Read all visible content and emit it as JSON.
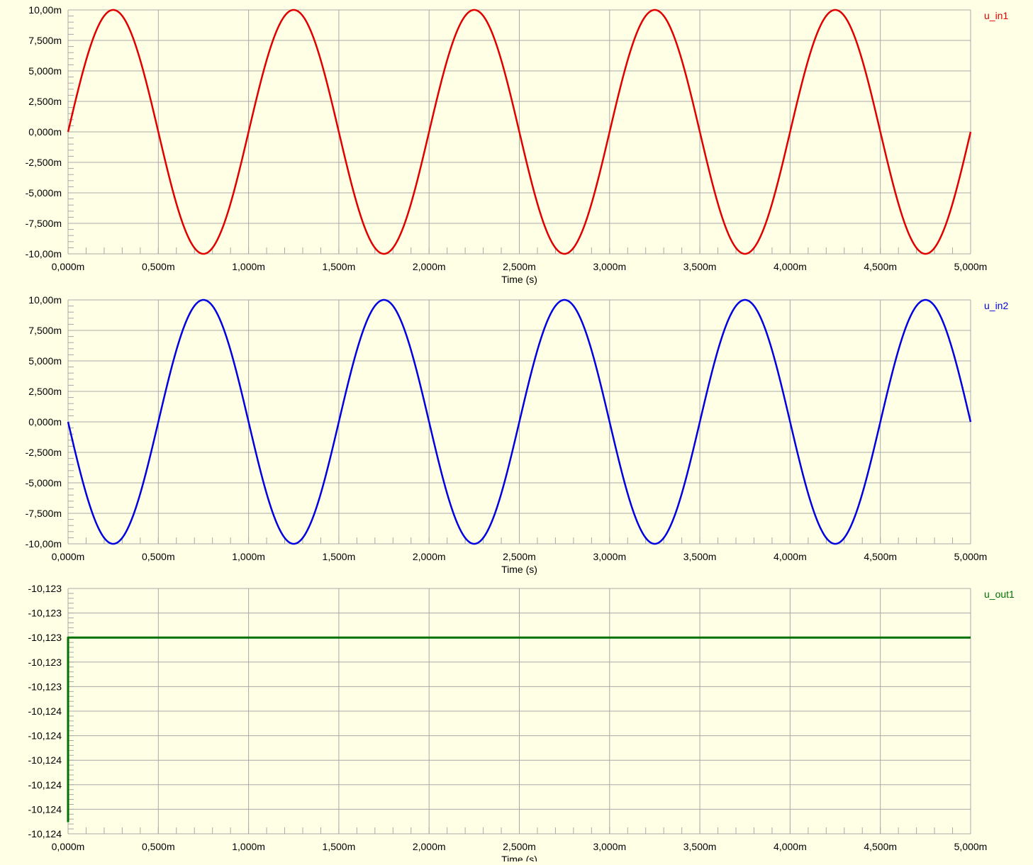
{
  "chart_data": [
    {
      "type": "line",
      "series": [
        {
          "name": "u_in1",
          "color": "#e00000",
          "function": "sine",
          "amplitude": 10,
          "frequency_hz": 1000,
          "phase_deg": 0
        }
      ],
      "x": {
        "label": "Time (s)",
        "unit": "s",
        "range": [
          0,
          0.005
        ],
        "ticks": [
          "0,000m",
          "0,500m",
          "1,000m",
          "1,500m",
          "2,000m",
          "2,500m",
          "3,000m",
          "3,500m",
          "4,000m",
          "4,500m",
          "5,000m"
        ]
      },
      "y": {
        "unit": "mV",
        "range": [
          -10,
          10
        ],
        "ticks": [
          "10,00m",
          "7,500m",
          "5,000m",
          "2,500m",
          "0,000m",
          "-2,500m",
          "-5,000m",
          "-7,500m",
          "-10,00m"
        ]
      },
      "grid": true,
      "legend": "top-right"
    },
    {
      "type": "line",
      "series": [
        {
          "name": "u_in2",
          "color": "#0000e0",
          "function": "sine",
          "amplitude": 10,
          "frequency_hz": 1000,
          "phase_deg": 180
        }
      ],
      "x": {
        "label": "Time (s)",
        "unit": "s",
        "range": [
          0,
          0.005
        ],
        "ticks": [
          "0,000m",
          "0,500m",
          "1,000m",
          "1,500m",
          "2,000m",
          "2,500m",
          "3,000m",
          "3,500m",
          "4,000m",
          "4,500m",
          "5,000m"
        ]
      },
      "y": {
        "unit": "mV",
        "range": [
          -10,
          10
        ],
        "ticks": [
          "10,00m",
          "7,500m",
          "5,000m",
          "2,500m",
          "0,000m",
          "-2,500m",
          "-5,000m",
          "-7,500m",
          "-10,00m"
        ]
      },
      "grid": true,
      "legend": "top-right"
    },
    {
      "type": "line",
      "series": [
        {
          "name": "u_out1",
          "color": "#007000",
          "function": "step",
          "start_value": -10.12395,
          "steady_value": -10.12316
        }
      ],
      "x": {
        "label": "Time (s)",
        "unit": "s",
        "range": [
          0,
          0.005
        ],
        "ticks": [
          "0,000m",
          "0,500m",
          "1,000m",
          "1,500m",
          "2,000m",
          "2,500m",
          "3,000m",
          "3,500m",
          "4,000m",
          "4,500m",
          "5,000m"
        ]
      },
      "y": {
        "unit": "V",
        "range": [
          -10.124,
          -10.12295
        ],
        "ticks": [
          "-10,123",
          "-10,123",
          "-10,123",
          "-10,123",
          "-10,123",
          "-10,124",
          "-10,124",
          "-10,124",
          "-10,124",
          "-10,124",
          "-10,124"
        ]
      },
      "grid": true,
      "legend": "top-right"
    }
  ]
}
